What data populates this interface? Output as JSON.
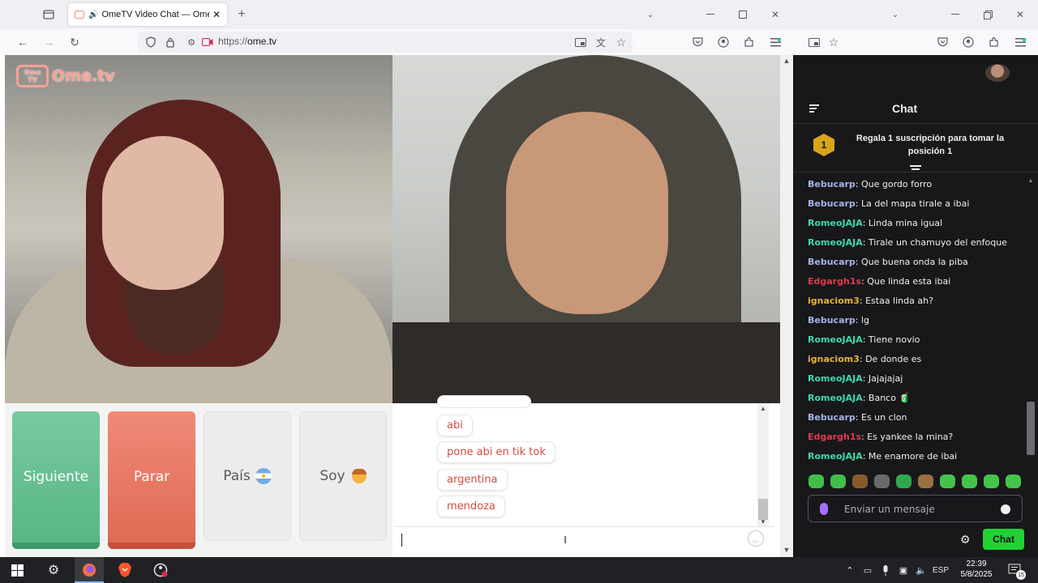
{
  "browser": {
    "tab_title": "OmeTV Video Chat — Ome",
    "url_prefix": "https://",
    "url_host": "ome.tv"
  },
  "ome": {
    "logo_text": "Ome.tv",
    "logo_badge": "Ome TV",
    "btn_next": "Siguiente",
    "btn_stop": "Parar",
    "btn_country": "País",
    "btn_gender": "Soy",
    "messages": [
      "abi",
      "pone abi en tik tok",
      "argentina",
      "mendoza"
    ]
  },
  "stream_chat": {
    "title": "Chat",
    "gift_rank": "1",
    "gift_text": "Regala 1 suscripción para tomar la posición 1",
    "lines": [
      {
        "user": "Bebucarp",
        "color": "#a5b3e8",
        "text": "Que gordo forro"
      },
      {
        "user": "Bebucarp",
        "color": "#a5b3e8",
        "text": "La del mapa tirale a ibai"
      },
      {
        "user": "RomeoJAJA",
        "color": "#3fd9a8",
        "text": "Linda mina igual"
      },
      {
        "user": "RomeoJAJA",
        "color": "#3fd9a8",
        "text": "Tirale un chamuyo del enfoque"
      },
      {
        "user": "Bebucarp",
        "color": "#a5b3e8",
        "text": "Que buena onda la piba"
      },
      {
        "user": "Edgargh1s",
        "color": "#e0394f",
        "text": "Que linda esta ibai"
      },
      {
        "user": "ignaciom3",
        "color": "#e6b23a",
        "text": "Estaa linda ah?"
      },
      {
        "user": "Bebucarp",
        "color": "#a5b3e8",
        "text": "lg"
      },
      {
        "user": "RomeoJAJA",
        "color": "#3fd9a8",
        "text": "Tiene novio"
      },
      {
        "user": "ignaciom3",
        "color": "#e6b23a",
        "text": "De donde es"
      },
      {
        "user": "RomeoJAJA",
        "color": "#3fd9a8",
        "text": "Jajajajaj"
      },
      {
        "user": "RomeoJAJA",
        "color": "#3fd9a8",
        "text": "Banco 🧃"
      },
      {
        "user": "Bebucarp",
        "color": "#a5b3e8",
        "text": "Es un clon"
      },
      {
        "user": "Edgargh1s",
        "color": "#e0394f",
        "text": "Es yankee la mina?"
      },
      {
        "user": "RomeoJAJA",
        "color": "#3fd9a8",
        "text": "Me enamore de ibai"
      }
    ],
    "emote_colors": [
      "#3fbf4a",
      "#3fbf4a",
      "#8a5a2b",
      "#6a6a6a",
      "#2fa84f",
      "#9a7040",
      "#44c44a",
      "#44c44a",
      "#44c44a",
      "#44c44a"
    ],
    "input_placeholder": "Enviar un mensaje",
    "send_label": "Chat"
  },
  "taskbar": {
    "lang": "ESP",
    "time": "22:39",
    "date": "5/8/2025",
    "notif_count": "15"
  }
}
